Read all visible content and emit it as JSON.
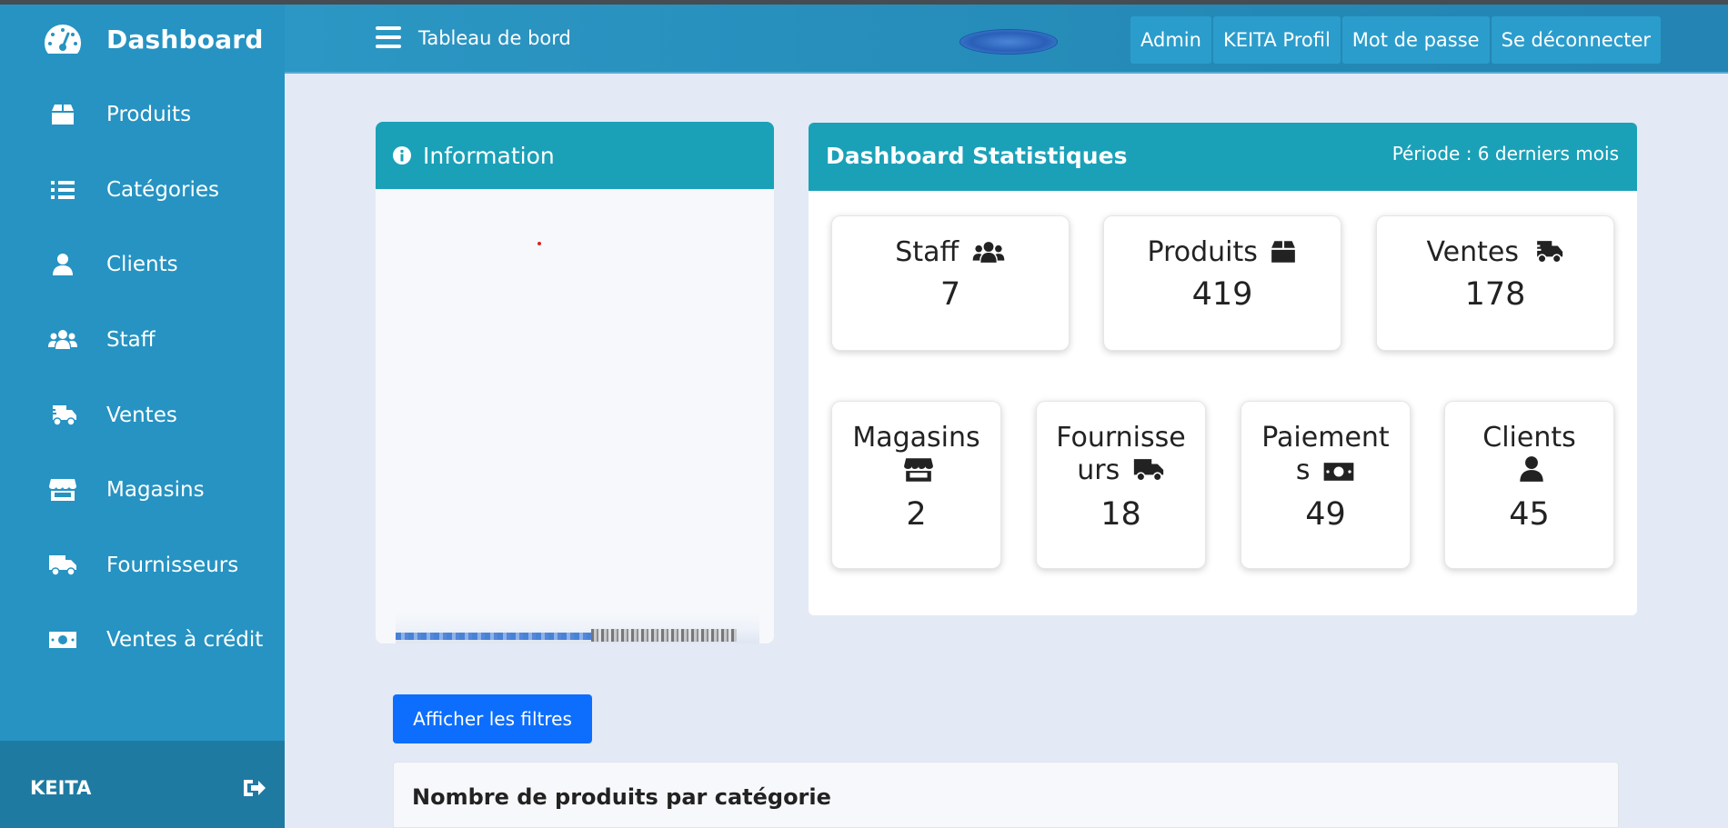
{
  "brand": {
    "title": "Dashboard",
    "icon": "speedometer-icon"
  },
  "sidebar": {
    "items": [
      {
        "label": "Produits",
        "icon": "box-icon"
      },
      {
        "label": "Catégories",
        "icon": "list-icon"
      },
      {
        "label": "Clients",
        "icon": "user-icon"
      },
      {
        "label": "Staff",
        "icon": "users-icon"
      },
      {
        "label": "Ventes",
        "icon": "shipping-fast-icon"
      },
      {
        "label": "Magasins",
        "icon": "store-icon"
      },
      {
        "label": "Fournisseurs",
        "icon": "truck-icon"
      },
      {
        "label": "Ventes à crédit",
        "icon": "money-bill-icon"
      }
    ],
    "footer": {
      "user": "KEITA",
      "logout_icon": "sign-out-icon"
    }
  },
  "topbar": {
    "title": "Tableau de bord",
    "nav": [
      "Admin",
      "KEITA Profil",
      "Mot de passe",
      "Se déconnecter"
    ]
  },
  "info": {
    "title": "Information"
  },
  "stats": {
    "title": "Dashboard Statistiques",
    "period": "Période : 6 derniers mois",
    "boxes": [
      {
        "label": "Staff",
        "value": "7",
        "icon": "users-icon"
      },
      {
        "label": "Produits",
        "value": "419",
        "icon": "box-icon"
      },
      {
        "label": "Ventes",
        "value": "178",
        "icon": "shipping-fast-icon"
      },
      {
        "label": "Magasins",
        "value": "2",
        "icon": "store-icon"
      },
      {
        "label": "Fournisseurs",
        "value": "18",
        "icon": "truck-icon"
      },
      {
        "label": "Paiements",
        "value": "49",
        "icon": "money-bill-icon"
      },
      {
        "label": "Clients",
        "value": "45",
        "icon": "user-icon"
      }
    ]
  },
  "filters": {
    "button_label": "Afficher les filtres"
  },
  "chart_section": {
    "title": "Nombre de produits par catégorie"
  },
  "colors": {
    "sidebar": "#2693c2",
    "header": "#1aa1b8",
    "primary_button": "#0d6efd",
    "background": "#e4e9f6"
  }
}
